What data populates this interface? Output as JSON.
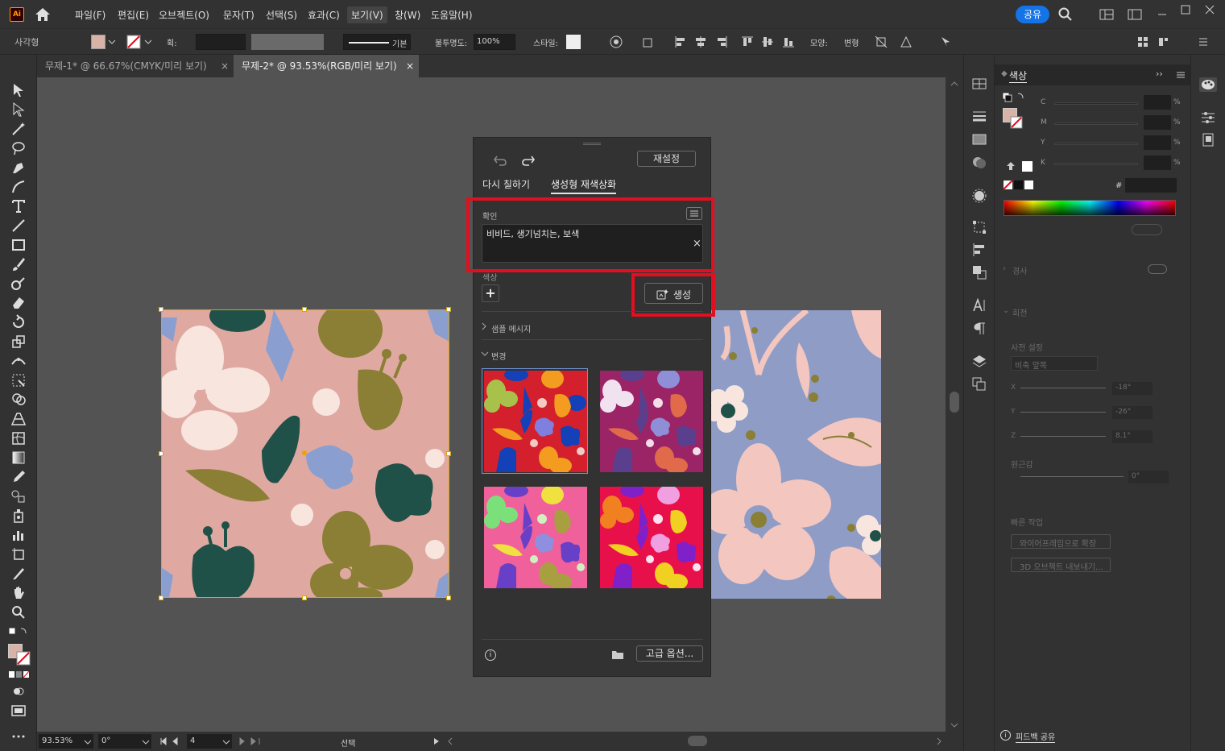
{
  "menubar": {
    "logo": "Ai",
    "items": [
      "파일(F)",
      "편집(E)",
      "오브젝트(O)",
      "문자(T)",
      "선택(S)",
      "효과(C)",
      "보기(V)",
      "창(W)",
      "도움말(H)"
    ],
    "share": "공유"
  },
  "control": {
    "object_type": "사각형",
    "stroke_label": "획:",
    "stroke_style": "기본",
    "opacity_label": "불투명도:",
    "opacity_value": "100%",
    "style_label": "스타일:",
    "shape_label": "모양:",
    "transform_label": "변형"
  },
  "tabs": [
    {
      "label": "무제-1* @ 66.67%(CMYK/미리 보기)",
      "close": "×"
    },
    {
      "label": "무제-2* @ 93.53%(RGB/미리 보기)",
      "close": "×"
    }
  ],
  "statusbar": {
    "zoom": "93.53%",
    "rotation": "0°",
    "artboard": "4",
    "mode": "선택"
  },
  "recolor": {
    "reset": "재설정",
    "tab_repaint": "다시 칠하기",
    "tab_generative": "생성형 재색상화",
    "prompt_label": "확인",
    "prompt_value": "비비드, 생기넘치는, 보색",
    "clear": "×",
    "color_label": "색상",
    "add": "+",
    "generate": "생성",
    "sample_label": "샘플 메시지",
    "variations_label": "변경",
    "advanced": "고급 옵션...",
    "info": "i"
  },
  "color_panel": {
    "title": "색상",
    "channels": [
      {
        "label": "C",
        "unit": "%"
      },
      {
        "label": "M",
        "unit": "%"
      },
      {
        "label": "Y",
        "unit": "%"
      },
      {
        "label": "K",
        "unit": "%"
      }
    ],
    "hex_label": "#"
  },
  "props_panel": {
    "cut": "경사",
    "rotation": "회전",
    "preset": "사전 설정",
    "preset_value": "비축 앞쪽",
    "x_label": "X",
    "x_value": "-18°",
    "y_label": "Y",
    "y_value": "-26°",
    "z_label": "Z",
    "z_value": "8.1°",
    "perspective": "원근감",
    "perspective_value": "0°",
    "quick": "빠른 작업",
    "action1": "와이어프레임으로 확장",
    "action2": "3D 오브젝트 내보내기...",
    "feedback": "피드백 공유"
  },
  "colors": {
    "accent_blue": "#1473e6",
    "highlight_red": "#e10f1f",
    "pattern1_bg": "#dfa9a2",
    "pattern2_bg": "#8e9cc6"
  }
}
